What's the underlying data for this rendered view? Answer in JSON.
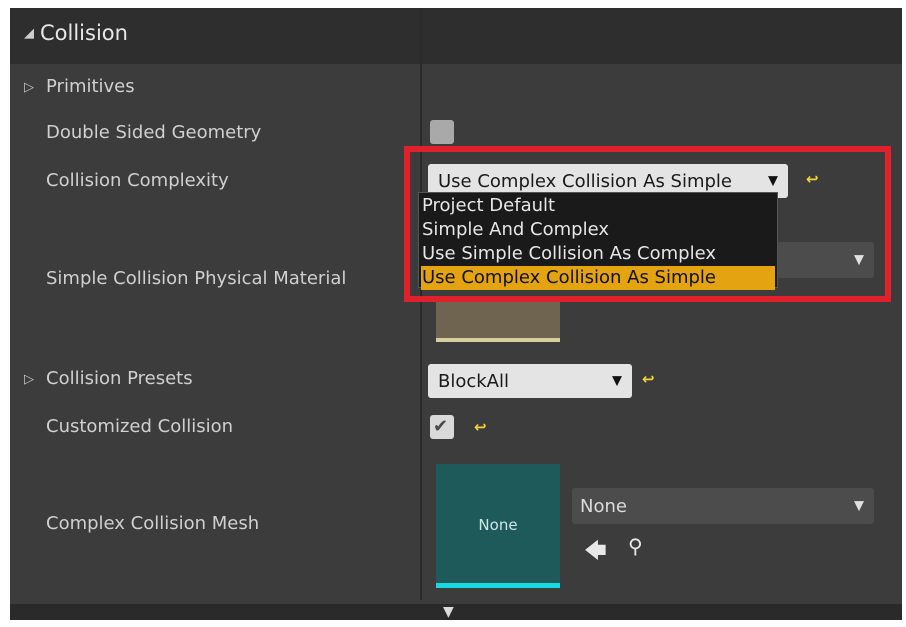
{
  "section": {
    "title": "Collision"
  },
  "rows": {
    "primitives": "Primitives",
    "double_sided": "Double Sided Geometry",
    "collision_complexity": "Collision Complexity",
    "simple_collision_material": "Simple Collision Physical Material",
    "collision_presets": "Collision Presets",
    "customized_collision": "Customized Collision",
    "complex_collision_mesh": "Complex Collision Mesh"
  },
  "collision_complexity": {
    "value": "Use Complex Collision As Simple",
    "options": [
      "Project Default",
      "Simple And Complex",
      "Use Simple Collision As Complex",
      "Use Complex Collision As Simple"
    ],
    "selected_index": 3
  },
  "collision_presets": {
    "value": "BlockAll"
  },
  "customized_collision": {
    "checked": true
  },
  "double_sided_geometry": {
    "checked": false
  },
  "complex_collision_mesh": {
    "thumbnail_label": "None",
    "value": "None"
  },
  "colors": {
    "highlight": "#e0202a",
    "selected_option": "#e4a412",
    "reset_icon": "#f2d43a",
    "mesh_thumb": "#1e5a5a",
    "mesh_thumb_bar": "#18d8e0"
  }
}
